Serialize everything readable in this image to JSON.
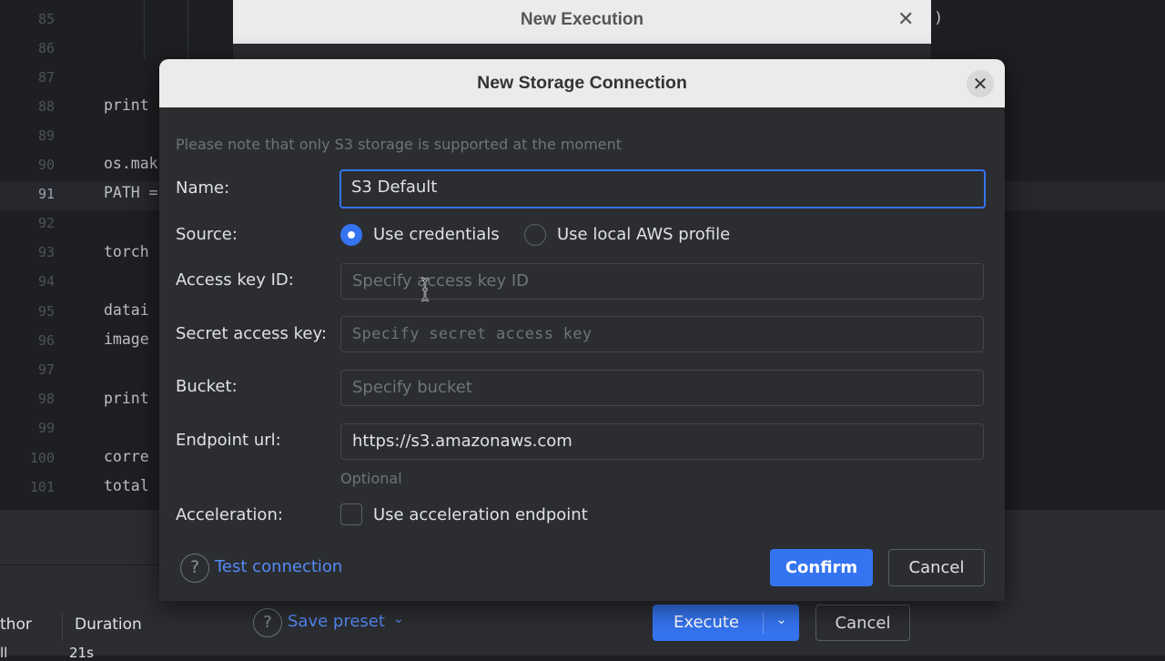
{
  "editor": {
    "line_numbers": [
      "85",
      "86",
      "87",
      "88",
      "89",
      "90",
      "91",
      "92",
      "93",
      "94",
      "95",
      "96",
      "97",
      "98",
      "99",
      "100",
      "101"
    ],
    "active_line": "91",
    "code": {
      "88": "print",
      "90": "os.mak",
      "91": "PATH =",
      "93": "torch",
      "95": "datai",
      "96": "image",
      "98": "print",
      "100": "corre",
      "101": "total"
    },
    "trailing_paren": ")"
  },
  "bottom_panel": {
    "columns": [
      "thor",
      "Duration"
    ],
    "row_partial": [
      "ll",
      "21s"
    ]
  },
  "exec_dialog": {
    "title": "New Execution",
    "close_glyph": "✕",
    "help_glyph": "?",
    "save_preset": "Save preset",
    "chevron": "⌄",
    "execute": "Execute",
    "execute_dropdown": "⌄",
    "cancel": "Cancel"
  },
  "storage_dialog": {
    "title": "New Storage Connection",
    "close_glyph": "✕",
    "note": "Please note that only S3 storage is supported at the moment",
    "name_label": "Name:",
    "name_value": "S3 Default",
    "source_label": "Source:",
    "source_options": [
      "Use credentials",
      "Use local AWS profile"
    ],
    "source_selected": "Use credentials",
    "access_key_label": "Access key ID:",
    "access_key_placeholder": "Specify access key ID",
    "secret_key_label": "Secret access key:",
    "secret_key_placeholder": "Specify secret access key",
    "bucket_label": "Bucket:",
    "bucket_placeholder": "Specify bucket",
    "endpoint_label": "Endpoint url:",
    "endpoint_value": "https://s3.amazonaws.com",
    "endpoint_hint": "Optional",
    "acceleration_label": "Acceleration:",
    "acceleration_option": "Use acceleration endpoint",
    "acceleration_checked": false,
    "help_glyph": "?",
    "test_connection": "Test connection",
    "confirm": "Confirm",
    "cancel": "Cancel"
  },
  "colors": {
    "accent": "#3574f0",
    "link": "#548af7",
    "dialog_bg": "#2b2d30",
    "title_bar": "#ebebeb"
  }
}
